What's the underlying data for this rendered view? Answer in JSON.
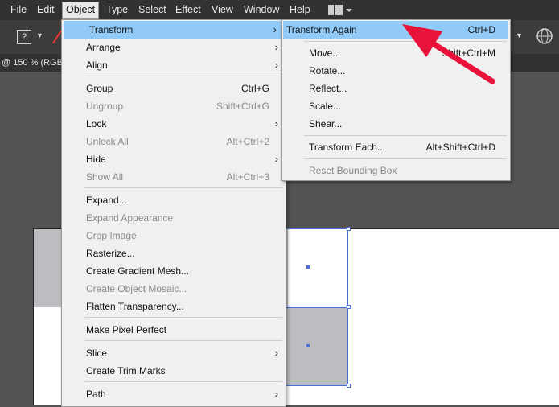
{
  "menubar": {
    "items": [
      "File",
      "Edit",
      "Object",
      "Type",
      "Select",
      "Effect",
      "View",
      "Window",
      "Help"
    ]
  },
  "toolbar": {
    "question_label": "?"
  },
  "doc_tab": {
    "label": "@ 150 % (RGB/"
  },
  "object_menu": {
    "items": [
      {
        "label": "Transform",
        "submenu": true,
        "highlight": true
      },
      {
        "label": "Arrange",
        "submenu": true
      },
      {
        "label": "Align",
        "submenu": true
      },
      {
        "label": "Group",
        "shortcut": "Ctrl+G"
      },
      {
        "label": "Ungroup",
        "shortcut": "Shift+Ctrl+G",
        "disabled": true
      },
      {
        "label": "Lock",
        "submenu": true
      },
      {
        "label": "Unlock All",
        "shortcut": "Alt+Ctrl+2",
        "disabled": true
      },
      {
        "label": "Hide",
        "submenu": true
      },
      {
        "label": "Show All",
        "shortcut": "Alt+Ctrl+3",
        "disabled": true
      },
      {
        "label": "Expand..."
      },
      {
        "label": "Expand Appearance",
        "disabled": true
      },
      {
        "label": "Crop Image",
        "disabled": true
      },
      {
        "label": "Rasterize..."
      },
      {
        "label": "Create Gradient Mesh..."
      },
      {
        "label": "Create Object Mosaic...",
        "disabled": true
      },
      {
        "label": "Flatten Transparency..."
      },
      {
        "label": "Make Pixel Perfect"
      },
      {
        "label": "Slice",
        "submenu": true
      },
      {
        "label": "Create Trim Marks"
      },
      {
        "label": "Path",
        "submenu": true
      }
    ]
  },
  "transform_menu": {
    "items": [
      {
        "label": "Transform Again",
        "shortcut": "Ctrl+D",
        "highlight": true
      },
      {
        "label": "Move...",
        "shortcut": "Shift+Ctrl+M"
      },
      {
        "label": "Rotate..."
      },
      {
        "label": "Reflect..."
      },
      {
        "label": "Scale..."
      },
      {
        "label": "Shear..."
      },
      {
        "label": "Transform Each...",
        "shortcut": "Alt+Shift+Ctrl+D"
      },
      {
        "label": "Reset Bounding Box",
        "disabled": true
      }
    ]
  },
  "colors": {
    "highlight": "#91c9f7",
    "annotation_arrow": "#e8123a",
    "selection": "#4a6fd8"
  }
}
